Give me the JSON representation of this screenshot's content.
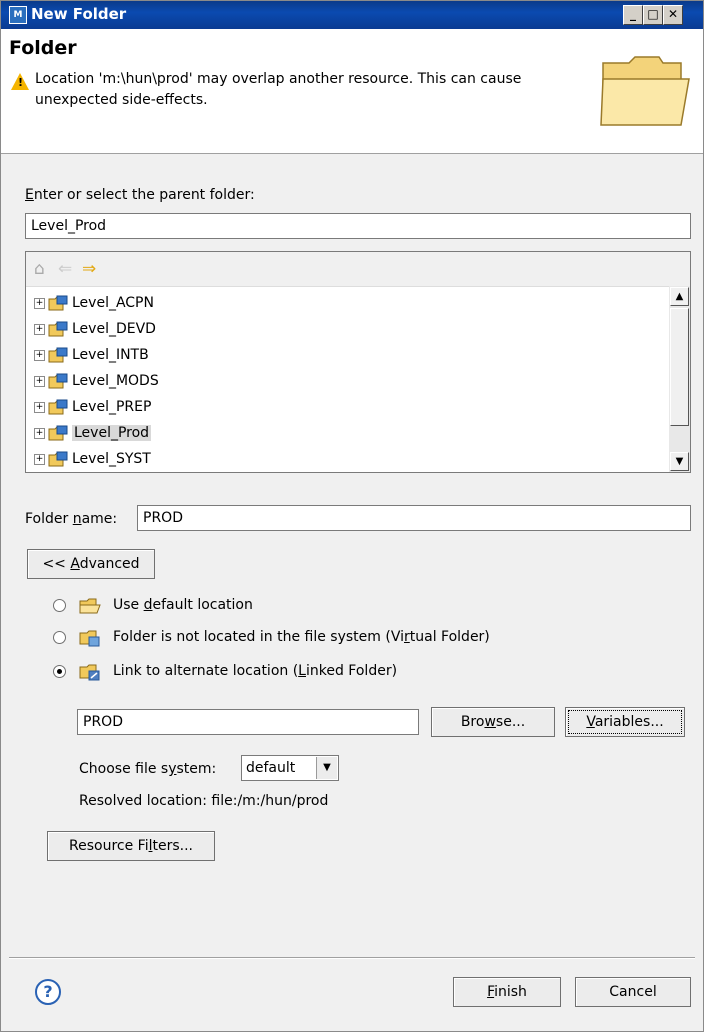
{
  "window": {
    "title": "New Folder",
    "icon": "eclipse-icon"
  },
  "header": {
    "title": "Folder",
    "warning": "Location 'm:\\hun\\prod' may overlap another resource. This can cause unexpected side-effects."
  },
  "parent": {
    "label_mnemonic": "E",
    "label_rest": "nter or select the parent folder:",
    "value": "Level_Prod"
  },
  "tree": {
    "items": [
      "Level_ACPN",
      "Level_DEVD",
      "Level_INTB",
      "Level_MODS",
      "Level_PREP",
      "Level_Prod",
      "Level_SYST"
    ],
    "selected": "Level_Prod"
  },
  "folder_name": {
    "label_pre": "Folder ",
    "label_mnemonic": "n",
    "label_post": "ame:",
    "value": "PROD"
  },
  "advanced_button": {
    "pre": "<< ",
    "mnemonic": "A",
    "post": "dvanced"
  },
  "options": [
    {
      "pre": "Use ",
      "mnemonic": "d",
      "post": "efault location",
      "checked": false
    },
    {
      "pre": "Folder is not located in the file system (Vi",
      "mnemonic": "r",
      "post": "tual Folder)",
      "checked": false
    },
    {
      "pre": "Link to alternate location (",
      "mnemonic": "L",
      "post": "inked Folder)",
      "checked": true
    }
  ],
  "location": {
    "value": "PROD",
    "browse": {
      "pre": "Bro",
      "mnemonic": "w",
      "post": "se..."
    },
    "variables": {
      "pre": "",
      "mnemonic": "V",
      "post": "ariables..."
    }
  },
  "file_system": {
    "label_pre": "Choose file s",
    "label_mnemonic": "y",
    "label_post": "stem:",
    "selected": "default"
  },
  "resolved": {
    "label": "Resolved location:",
    "value": "file:/m:/hun/prod"
  },
  "resource_filters": {
    "pre": "Resource Fi",
    "mnemonic": "l",
    "post": "ters..."
  },
  "footer": {
    "finish": {
      "pre": "",
      "mnemonic": "F",
      "post": "inish"
    },
    "cancel": "Cancel"
  }
}
